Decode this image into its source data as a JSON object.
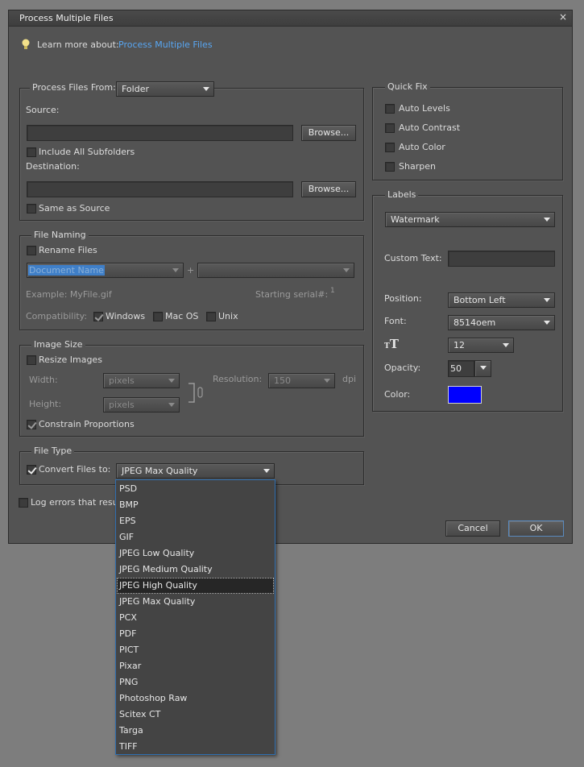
{
  "window": {
    "title": "Process Multiple Files",
    "close_glyph": "×"
  },
  "learn": {
    "prefix": "Learn more about:",
    "link": "Process Multiple Files",
    "icon": "lightbulb-icon"
  },
  "process_from": {
    "legend": "Process Files From:",
    "selected": "Folder",
    "source_label": "Source:",
    "source_value": "",
    "browse": "Browse...",
    "include_subfolders": "Include All Subfolders",
    "destination_label": "Destination:",
    "destination_value": "",
    "same_as_source": "Same as Source"
  },
  "file_naming": {
    "legend": "File Naming",
    "rename_files": "Rename Files",
    "name_select": "Document Name",
    "plus": "+",
    "second_select": "",
    "example": "Example: MyFile.gif",
    "serial_label": "Starting serial#:",
    "serial_value": "1",
    "compat_label": "Compatibility:",
    "windows": "Windows",
    "mac": "Mac OS",
    "unix": "Unix"
  },
  "image_size": {
    "legend": "Image Size",
    "resize": "Resize Images",
    "width_label": "Width:",
    "height_label": "Height:",
    "unit": "pixels",
    "resolution_label": "Resolution:",
    "resolution_value": "150",
    "resolution_unit": "dpi",
    "constrain": "Constrain Proportions"
  },
  "file_type": {
    "legend": "File Type",
    "convert": "Convert Files to:",
    "selected": "JPEG Max Quality",
    "options": [
      "PSD",
      "BMP",
      "EPS",
      "GIF",
      "JPEG Low Quality",
      "JPEG Medium Quality",
      "JPEG High Quality",
      "JPEG Max Quality",
      "PCX",
      "PDF",
      "PICT",
      "Pixar",
      "PNG",
      "Photoshop Raw",
      "Scitex CT",
      "Targa",
      "TIFF"
    ],
    "highlighted": "JPEG High Quality"
  },
  "log_errors": "Log errors that resul",
  "quick_fix": {
    "legend": "Quick Fix",
    "items": [
      "Auto Levels",
      "Auto Contrast",
      "Auto Color",
      "Sharpen"
    ]
  },
  "labels": {
    "legend": "Labels",
    "type": "Watermark",
    "custom_text_label": "Custom Text:",
    "custom_text_value": "",
    "position_label": "Position:",
    "position_value": "Bottom Left",
    "font_label": "Font:",
    "font_value": "8514oem",
    "size_value": "12",
    "opacity_label": "Opacity:",
    "opacity_value": "50",
    "color_label": "Color:",
    "color_value": "#0000ff"
  },
  "buttons": {
    "cancel": "Cancel",
    "ok": "OK"
  }
}
